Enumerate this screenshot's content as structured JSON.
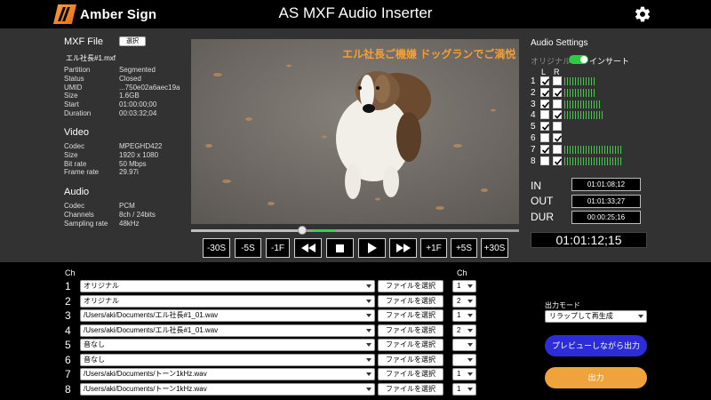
{
  "header": {
    "logo_text": "Amber Sign",
    "title": "AS MXF Audio Inserter",
    "settings_icon": "gear-icon"
  },
  "mxf": {
    "section": "MXF File",
    "select_label": "選択",
    "file_name": "エル社長#1.mxf",
    "rows": [
      {
        "k": "Partition",
        "v": "Segmented"
      },
      {
        "k": "Status",
        "v": "Closed"
      },
      {
        "k": "UMID",
        "v": "...750e02a6aec19a"
      },
      {
        "k": "Size",
        "v": "1.6GB"
      },
      {
        "k": "Start",
        "v": "01:00:00;00"
      },
      {
        "k": "Duration",
        "v": "00:03:32;04"
      }
    ]
  },
  "video_info": {
    "section": "Video",
    "rows": [
      {
        "k": "Codec",
        "v": "MPEGHD422"
      },
      {
        "k": "Size",
        "v": "1920 x 1080"
      },
      {
        "k": "Bit rate",
        "v": "50 Mbps"
      },
      {
        "k": "Frame rate",
        "v": "29.97i"
      }
    ]
  },
  "audio_info": {
    "section": "Audio",
    "rows": [
      {
        "k": "Codec",
        "v": "PCM"
      },
      {
        "k": "Channels",
        "v": "8ch / 24bits"
      },
      {
        "k": "Sampling rate",
        "v": "48kHz"
      }
    ]
  },
  "player": {
    "caption": "エル社長ご機嫌 ドッグランでご満悦",
    "position": 0.34,
    "in_mark": 0.37,
    "out_mark": 0.44,
    "buttons": [
      "-30S",
      "-5S",
      "-1F",
      "rewind",
      "stop",
      "play",
      "fast-forward",
      "+1F",
      "+5S",
      "+30S"
    ]
  },
  "audio_settings": {
    "title": "Audio Settings",
    "original_label": "オリジナル",
    "insert_label": "インサート",
    "toggle_on": true,
    "l_label": "L",
    "r_label": "R",
    "channels": [
      {
        "n": "1",
        "l": true,
        "r": false,
        "level": 0.55
      },
      {
        "n": "2",
        "l": true,
        "r": true,
        "level": 0.55
      },
      {
        "n": "3",
        "l": true,
        "r": false,
        "level": 0.65
      },
      {
        "n": "4",
        "l": false,
        "r": true,
        "level": 0.7
      },
      {
        "n": "5",
        "l": true,
        "r": false,
        "level": 0
      },
      {
        "n": "6",
        "l": false,
        "r": true,
        "level": 0
      },
      {
        "n": "7",
        "l": true,
        "r": false,
        "level": 1.0
      },
      {
        "n": "8",
        "l": false,
        "r": true,
        "level": 1.0
      }
    ]
  },
  "io": {
    "in_label": "IN",
    "in_value": "01:01:08;12",
    "out_label": "OUT",
    "out_value": "01:01:33;27",
    "dur_label": "DUR",
    "dur_value": "00:00:25;16"
  },
  "timecode": "01:01:12;15",
  "assign": {
    "ch_header": "Ch",
    "ch_header2": "Ch",
    "file_button": "ファイルを選択",
    "rows": [
      {
        "n": "1",
        "src": "オリジナル",
        "ch": "1"
      },
      {
        "n": "2",
        "src": "オリジナル",
        "ch": "2"
      },
      {
        "n": "3",
        "src": "/Users/aki/Documents/エル社長#1_01.wav",
        "ch": "1"
      },
      {
        "n": "4",
        "src": "/Users/aki/Documents/エル社長#1_01.wav",
        "ch": "2"
      },
      {
        "n": "5",
        "src": "音なし",
        "ch": ""
      },
      {
        "n": "6",
        "src": "音なし",
        "ch": ""
      },
      {
        "n": "7",
        "src": "/Users/aki/Documents/トーン1kHz.wav",
        "ch": "1"
      },
      {
        "n": "8",
        "src": "/Users/aki/Documents/トーン1kHz.wav",
        "ch": "1"
      }
    ]
  },
  "output": {
    "mode_label": "出力モード",
    "mode_value": "リラップして再生成",
    "preview_label": "プレビューしながら出力",
    "output_label": "出力"
  }
}
